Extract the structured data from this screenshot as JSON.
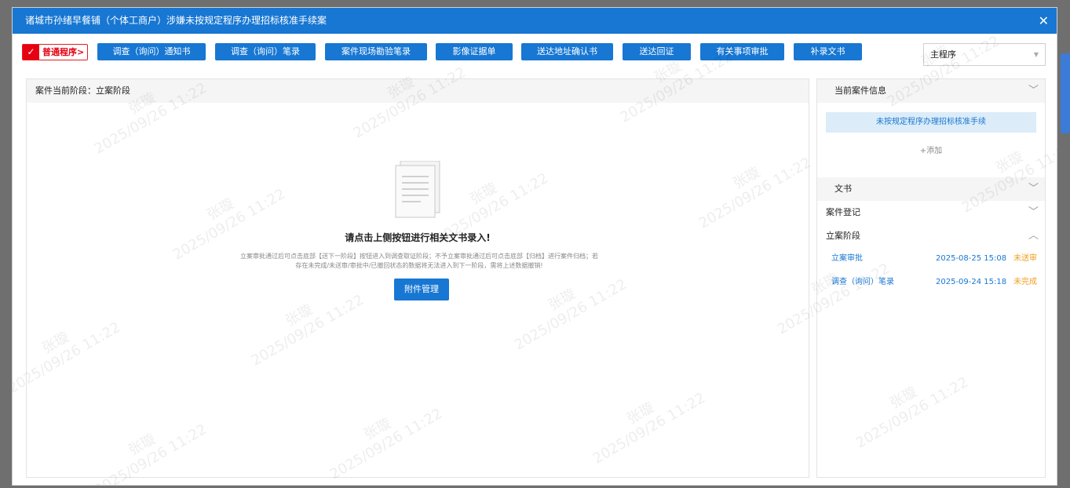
{
  "dialog": {
    "title": "诸城市孙绪早餐铺（个体工商户）涉嫌未按规定程序办理招标核准手续案",
    "close_icon": "close-icon"
  },
  "toolbar": {
    "procedure_badge": "普通程序>",
    "buttons": [
      "调查（询问）通知书",
      "调查（询问）笔录",
      "案件现场勘验笔录",
      "影像证据单",
      "送达地址确认书",
      "送达回证",
      "有关事项审批",
      "补录文书"
    ],
    "select_value": "主程序"
  },
  "left_panel": {
    "header": "案件当前阶段：立案阶段",
    "empty_title": "请点击上侧按钮进行相关文书录入!",
    "empty_desc": "立案审批通过后可点击底部【送下一阶段】按钮进入到调查取证阶段；不予立案审批通过后可点击底部【归档】进行案件归档；若存在未完成/未送审/审批中/已撤回状态的数据将无法进入到下一阶段，需将上述数据撤销!",
    "attach_button": "附件管理"
  },
  "right_panel": {
    "case_info_header": "当前案件信息",
    "case_tag": "未按规定程序办理招标核准手续",
    "add_link": "+添加",
    "docs_header": "文书",
    "register_header": "案件登记",
    "stage_header": "立案阶段",
    "rows": [
      {
        "name": "立案审批",
        "time": "2025-08-25 15:08",
        "status": "未送审"
      },
      {
        "name": "调查（询问）笔录",
        "time": "2025-09-24 15:18",
        "status": "未完成"
      }
    ]
  },
  "watermark": {
    "name": "张璇",
    "time": "2025/09/26 11:22"
  },
  "colors": {
    "primary": "#1777d3",
    "danger": "#e60012",
    "warning": "#f0a020"
  }
}
